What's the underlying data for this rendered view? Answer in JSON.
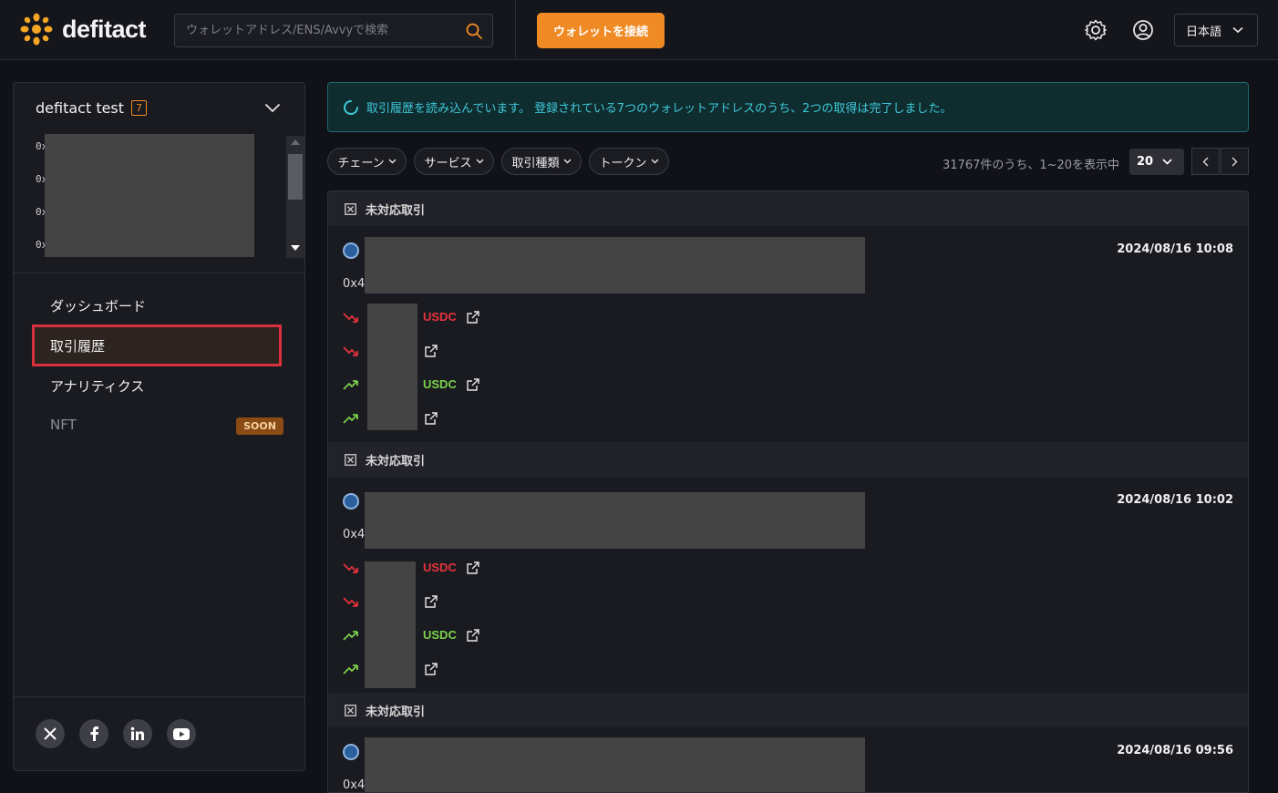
{
  "header": {
    "logo_text": "defitact",
    "search_placeholder": "ウォレットアドレス/ENS/Avvyで検索",
    "connect_label": "ウォレットを接続",
    "language": "日本語"
  },
  "sidebar": {
    "account_name": "defitact test",
    "account_count": "7",
    "addresses": [
      "0x",
      "0x",
      "0x",
      "0x"
    ],
    "nav": [
      {
        "label": "ダッシュボード"
      },
      {
        "label": "取引履歴"
      },
      {
        "label": "アナリティクス"
      },
      {
        "label": "NFT",
        "badge": "SOON"
      }
    ],
    "social": [
      "x-icon",
      "facebook-icon",
      "linkedin-icon",
      "youtube-icon"
    ]
  },
  "banner": {
    "text": "取引履歴を読み込んでいます。 登録されている7つのウォレットアドレスのうち、2つの取得は完了しました。"
  },
  "filters": [
    "チェーン",
    "サービス",
    "取引種類",
    "トークン"
  ],
  "pagination": {
    "summary": "31767件のうち、1~20を表示中",
    "per_page": "20"
  },
  "transactions": [
    {
      "group_label": "未対応取引",
      "hash_prefix": "0x4",
      "date": "2024/08/16 10:08",
      "transfers": [
        {
          "direction": "out",
          "token": "USDC"
        },
        {
          "direction": "out",
          "token": ""
        },
        {
          "direction": "in",
          "token": "USDC"
        },
        {
          "direction": "in",
          "token": ""
        }
      ]
    },
    {
      "group_label": "未対応取引",
      "hash_prefix": "0x4",
      "date": "2024/08/16 10:02",
      "transfers": [
        {
          "direction": "out",
          "token": "USDC"
        },
        {
          "direction": "out",
          "token": ""
        },
        {
          "direction": "in",
          "token": "USDC"
        },
        {
          "direction": "in",
          "token": ""
        }
      ]
    },
    {
      "group_label": "未対応取引",
      "hash_prefix": "0x4",
      "date": "2024/08/16 09:56",
      "transfers": []
    }
  ],
  "colors": {
    "accent": "#f08a24",
    "out": "#e8323c",
    "in": "#7bd04a",
    "banner_text": "#3fc8d8",
    "active_border": "#d8303c"
  }
}
